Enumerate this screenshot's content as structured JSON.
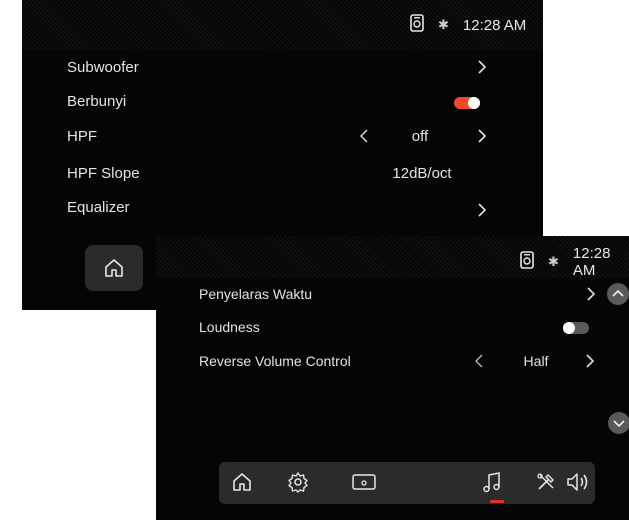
{
  "back_screen": {
    "status": {
      "time": "12:28 AM",
      "bluetooth_icon": "bluetooth-icon",
      "phone_icon": "phone-link-icon"
    },
    "rows": [
      {
        "label": "Subwoofer",
        "value": "",
        "control": "chevron"
      },
      {
        "label": "Berbunyi",
        "value": "",
        "control": "toggle",
        "toggle_on": true
      },
      {
        "label": "HPF",
        "value": "off",
        "control": "stepper"
      },
      {
        "label": "HPF Slope",
        "value": "12dB/oct",
        "control": "value"
      },
      {
        "label": "Equalizer",
        "value": "",
        "control": "chevron"
      }
    ],
    "home_icon": "home-icon"
  },
  "front_screen": {
    "status": {
      "time": "12:28 AM",
      "bluetooth_icon": "bluetooth-icon",
      "phone_icon": "phone-link-icon"
    },
    "rows": [
      {
        "label": "Penyelaras Waktu",
        "value": "",
        "control": "chevron"
      },
      {
        "label": "Loudness",
        "value": "",
        "control": "toggle",
        "toggle_on": false
      },
      {
        "label": "Reverse Volume Control",
        "value": "Half",
        "control": "stepper"
      }
    ],
    "dock": {
      "items": [
        "home-icon",
        "settings-icon",
        "screen-icon",
        "music-icon",
        "tools-icon",
        "volume-icon"
      ],
      "active": "music-icon"
    },
    "scroll_up_icon": "chevron-up-icon",
    "scroll_down_icon": "chevron-down-icon"
  },
  "colors": {
    "toggle_on": "#f24a2b",
    "toggle_off": "#5a5a5a",
    "active_indicator": "#e0322a",
    "background": "#050505",
    "dock": "#2b2b2b"
  }
}
